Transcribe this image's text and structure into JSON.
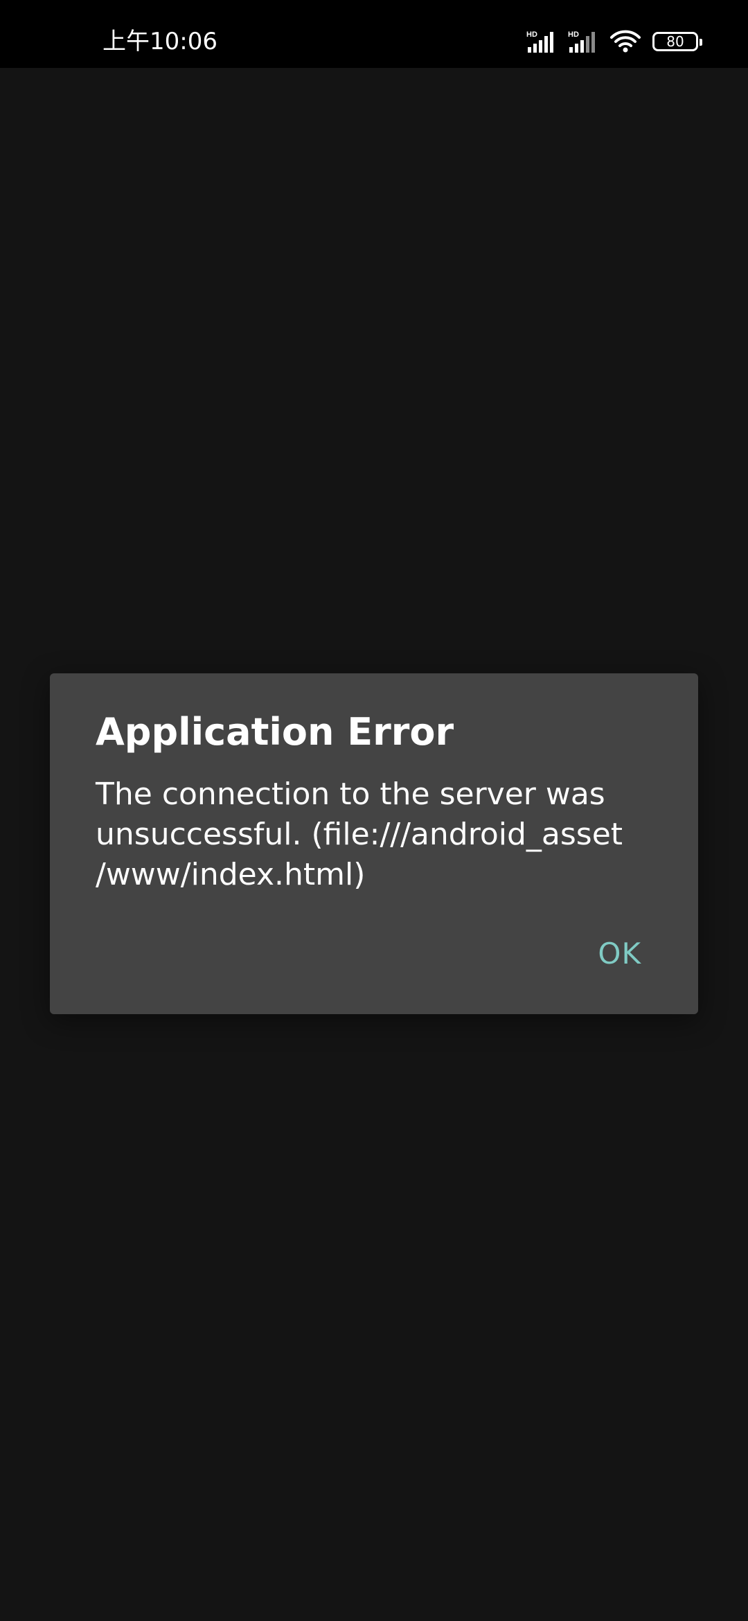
{
  "status_bar": {
    "time": "上午10:06",
    "signal_1_label": "HD",
    "signal_2_label": "HD",
    "battery_level": "80",
    "icons": [
      "signal-icon",
      "signal-icon",
      "wifi-icon",
      "battery-icon"
    ]
  },
  "dialog": {
    "title": "Application Error",
    "message": "The connection to the server was\nunsuccessful. (file:///android_asset\n/www/index.html)",
    "ok_label": "OK",
    "ok_color": "#80cbc4",
    "background_color": "#444444"
  },
  "screen": {
    "background_color": "#141414"
  }
}
